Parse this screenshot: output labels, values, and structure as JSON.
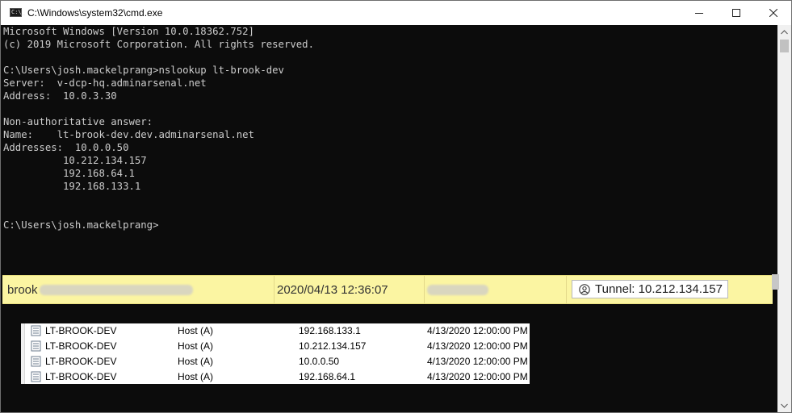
{
  "window": {
    "title": "C:\\Windows\\system32\\cmd.exe",
    "icon_text": "C:\\_"
  },
  "console": {
    "lines": [
      "Microsoft Windows [Version 10.0.18362.752]",
      "(c) 2019 Microsoft Corporation. All rights reserved.",
      "",
      "C:\\Users\\josh.mackelprang>nslookup lt-brook-dev",
      "Server:  v-dcp-hq.adminarsenal.net",
      "Address:  10.0.3.30",
      "",
      "Non-authoritative answer:",
      "Name:    lt-brook-dev.dev.adminarsenal.net",
      "Addresses:  10.0.0.50",
      "          10.212.134.157",
      "          192.168.64.1",
      "          192.168.133.1",
      "",
      "",
      "C:\\Users\\josh.mackelprang>"
    ]
  },
  "status_row": {
    "user": "brook",
    "timestamp": "2020/04/13 12:36:07",
    "tunnel_label": "Tunnel: 10.212.134.157"
  },
  "dns_records": [
    {
      "name": "LT-BROOK-DEV",
      "type": "Host (A)",
      "data": "192.168.133.1",
      "timestamp": "4/13/2020 12:00:00 PM"
    },
    {
      "name": "LT-BROOK-DEV",
      "type": "Host (A)",
      "data": "10.212.134.157",
      "timestamp": "4/13/2020 12:00:00 PM"
    },
    {
      "name": "LT-BROOK-DEV",
      "type": "Host (A)",
      "data": "10.0.0.50",
      "timestamp": "4/13/2020 12:00:00 PM"
    },
    {
      "name": "LT-BROOK-DEV",
      "type": "Host (A)",
      "data": "192.168.64.1",
      "timestamp": "4/13/2020 12:00:00 PM"
    }
  ],
  "icons": {
    "app": "cmd-app-icon",
    "minimize": "minimize-icon",
    "maximize": "maximize-icon",
    "close": "close-icon",
    "tunnel": "tunnel-user-icon",
    "record": "dns-record-icon"
  },
  "colors": {
    "console_bg": "#0c0c0c",
    "console_text": "#cccccc",
    "highlight_bg": "#fbf5a2"
  }
}
